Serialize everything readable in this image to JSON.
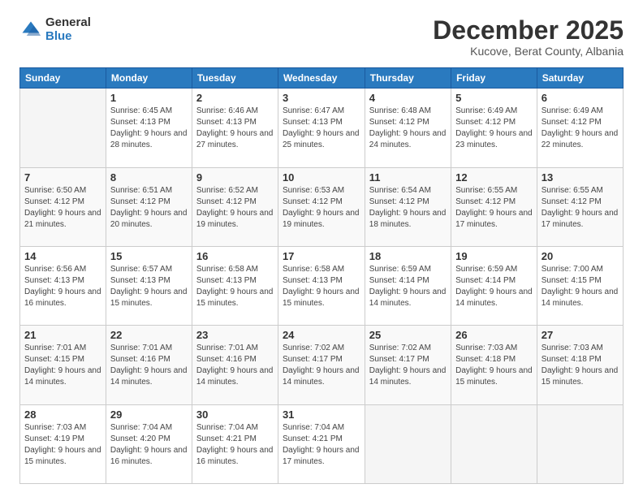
{
  "logo": {
    "general": "General",
    "blue": "Blue"
  },
  "header": {
    "month": "December 2025",
    "location": "Kucove, Berat County, Albania"
  },
  "days_of_week": [
    "Sunday",
    "Monday",
    "Tuesday",
    "Wednesday",
    "Thursday",
    "Friday",
    "Saturday"
  ],
  "weeks": [
    [
      {
        "day": "",
        "empty": true
      },
      {
        "day": "1",
        "sunrise": "Sunrise: 6:45 AM",
        "sunset": "Sunset: 4:13 PM",
        "daylight": "Daylight: 9 hours and 28 minutes."
      },
      {
        "day": "2",
        "sunrise": "Sunrise: 6:46 AM",
        "sunset": "Sunset: 4:13 PM",
        "daylight": "Daylight: 9 hours and 27 minutes."
      },
      {
        "day": "3",
        "sunrise": "Sunrise: 6:47 AM",
        "sunset": "Sunset: 4:13 PM",
        "daylight": "Daylight: 9 hours and 25 minutes."
      },
      {
        "day": "4",
        "sunrise": "Sunrise: 6:48 AM",
        "sunset": "Sunset: 4:12 PM",
        "daylight": "Daylight: 9 hours and 24 minutes."
      },
      {
        "day": "5",
        "sunrise": "Sunrise: 6:49 AM",
        "sunset": "Sunset: 4:12 PM",
        "daylight": "Daylight: 9 hours and 23 minutes."
      },
      {
        "day": "6",
        "sunrise": "Sunrise: 6:49 AM",
        "sunset": "Sunset: 4:12 PM",
        "daylight": "Daylight: 9 hours and 22 minutes."
      }
    ],
    [
      {
        "day": "7",
        "sunrise": "Sunrise: 6:50 AM",
        "sunset": "Sunset: 4:12 PM",
        "daylight": "Daylight: 9 hours and 21 minutes."
      },
      {
        "day": "8",
        "sunrise": "Sunrise: 6:51 AM",
        "sunset": "Sunset: 4:12 PM",
        "daylight": "Daylight: 9 hours and 20 minutes."
      },
      {
        "day": "9",
        "sunrise": "Sunrise: 6:52 AM",
        "sunset": "Sunset: 4:12 PM",
        "daylight": "Daylight: 9 hours and 19 minutes."
      },
      {
        "day": "10",
        "sunrise": "Sunrise: 6:53 AM",
        "sunset": "Sunset: 4:12 PM",
        "daylight": "Daylight: 9 hours and 19 minutes."
      },
      {
        "day": "11",
        "sunrise": "Sunrise: 6:54 AM",
        "sunset": "Sunset: 4:12 PM",
        "daylight": "Daylight: 9 hours and 18 minutes."
      },
      {
        "day": "12",
        "sunrise": "Sunrise: 6:55 AM",
        "sunset": "Sunset: 4:12 PM",
        "daylight": "Daylight: 9 hours and 17 minutes."
      },
      {
        "day": "13",
        "sunrise": "Sunrise: 6:55 AM",
        "sunset": "Sunset: 4:12 PM",
        "daylight": "Daylight: 9 hours and 17 minutes."
      }
    ],
    [
      {
        "day": "14",
        "sunrise": "Sunrise: 6:56 AM",
        "sunset": "Sunset: 4:13 PM",
        "daylight": "Daylight: 9 hours and 16 minutes."
      },
      {
        "day": "15",
        "sunrise": "Sunrise: 6:57 AM",
        "sunset": "Sunset: 4:13 PM",
        "daylight": "Daylight: 9 hours and 15 minutes."
      },
      {
        "day": "16",
        "sunrise": "Sunrise: 6:58 AM",
        "sunset": "Sunset: 4:13 PM",
        "daylight": "Daylight: 9 hours and 15 minutes."
      },
      {
        "day": "17",
        "sunrise": "Sunrise: 6:58 AM",
        "sunset": "Sunset: 4:13 PM",
        "daylight": "Daylight: 9 hours and 15 minutes."
      },
      {
        "day": "18",
        "sunrise": "Sunrise: 6:59 AM",
        "sunset": "Sunset: 4:14 PM",
        "daylight": "Daylight: 9 hours and 14 minutes."
      },
      {
        "day": "19",
        "sunrise": "Sunrise: 6:59 AM",
        "sunset": "Sunset: 4:14 PM",
        "daylight": "Daylight: 9 hours and 14 minutes."
      },
      {
        "day": "20",
        "sunrise": "Sunrise: 7:00 AM",
        "sunset": "Sunset: 4:15 PM",
        "daylight": "Daylight: 9 hours and 14 minutes."
      }
    ],
    [
      {
        "day": "21",
        "sunrise": "Sunrise: 7:01 AM",
        "sunset": "Sunset: 4:15 PM",
        "daylight": "Daylight: 9 hours and 14 minutes."
      },
      {
        "day": "22",
        "sunrise": "Sunrise: 7:01 AM",
        "sunset": "Sunset: 4:16 PM",
        "daylight": "Daylight: 9 hours and 14 minutes."
      },
      {
        "day": "23",
        "sunrise": "Sunrise: 7:01 AM",
        "sunset": "Sunset: 4:16 PM",
        "daylight": "Daylight: 9 hours and 14 minutes."
      },
      {
        "day": "24",
        "sunrise": "Sunrise: 7:02 AM",
        "sunset": "Sunset: 4:17 PM",
        "daylight": "Daylight: 9 hours and 14 minutes."
      },
      {
        "day": "25",
        "sunrise": "Sunrise: 7:02 AM",
        "sunset": "Sunset: 4:17 PM",
        "daylight": "Daylight: 9 hours and 14 minutes."
      },
      {
        "day": "26",
        "sunrise": "Sunrise: 7:03 AM",
        "sunset": "Sunset: 4:18 PM",
        "daylight": "Daylight: 9 hours and 15 minutes."
      },
      {
        "day": "27",
        "sunrise": "Sunrise: 7:03 AM",
        "sunset": "Sunset: 4:18 PM",
        "daylight": "Daylight: 9 hours and 15 minutes."
      }
    ],
    [
      {
        "day": "28",
        "sunrise": "Sunrise: 7:03 AM",
        "sunset": "Sunset: 4:19 PM",
        "daylight": "Daylight: 9 hours and 15 minutes."
      },
      {
        "day": "29",
        "sunrise": "Sunrise: 7:04 AM",
        "sunset": "Sunset: 4:20 PM",
        "daylight": "Daylight: 9 hours and 16 minutes."
      },
      {
        "day": "30",
        "sunrise": "Sunrise: 7:04 AM",
        "sunset": "Sunset: 4:21 PM",
        "daylight": "Daylight: 9 hours and 16 minutes."
      },
      {
        "day": "31",
        "sunrise": "Sunrise: 7:04 AM",
        "sunset": "Sunset: 4:21 PM",
        "daylight": "Daylight: 9 hours and 17 minutes."
      },
      {
        "day": "",
        "empty": true
      },
      {
        "day": "",
        "empty": true
      },
      {
        "day": "",
        "empty": true
      }
    ]
  ]
}
